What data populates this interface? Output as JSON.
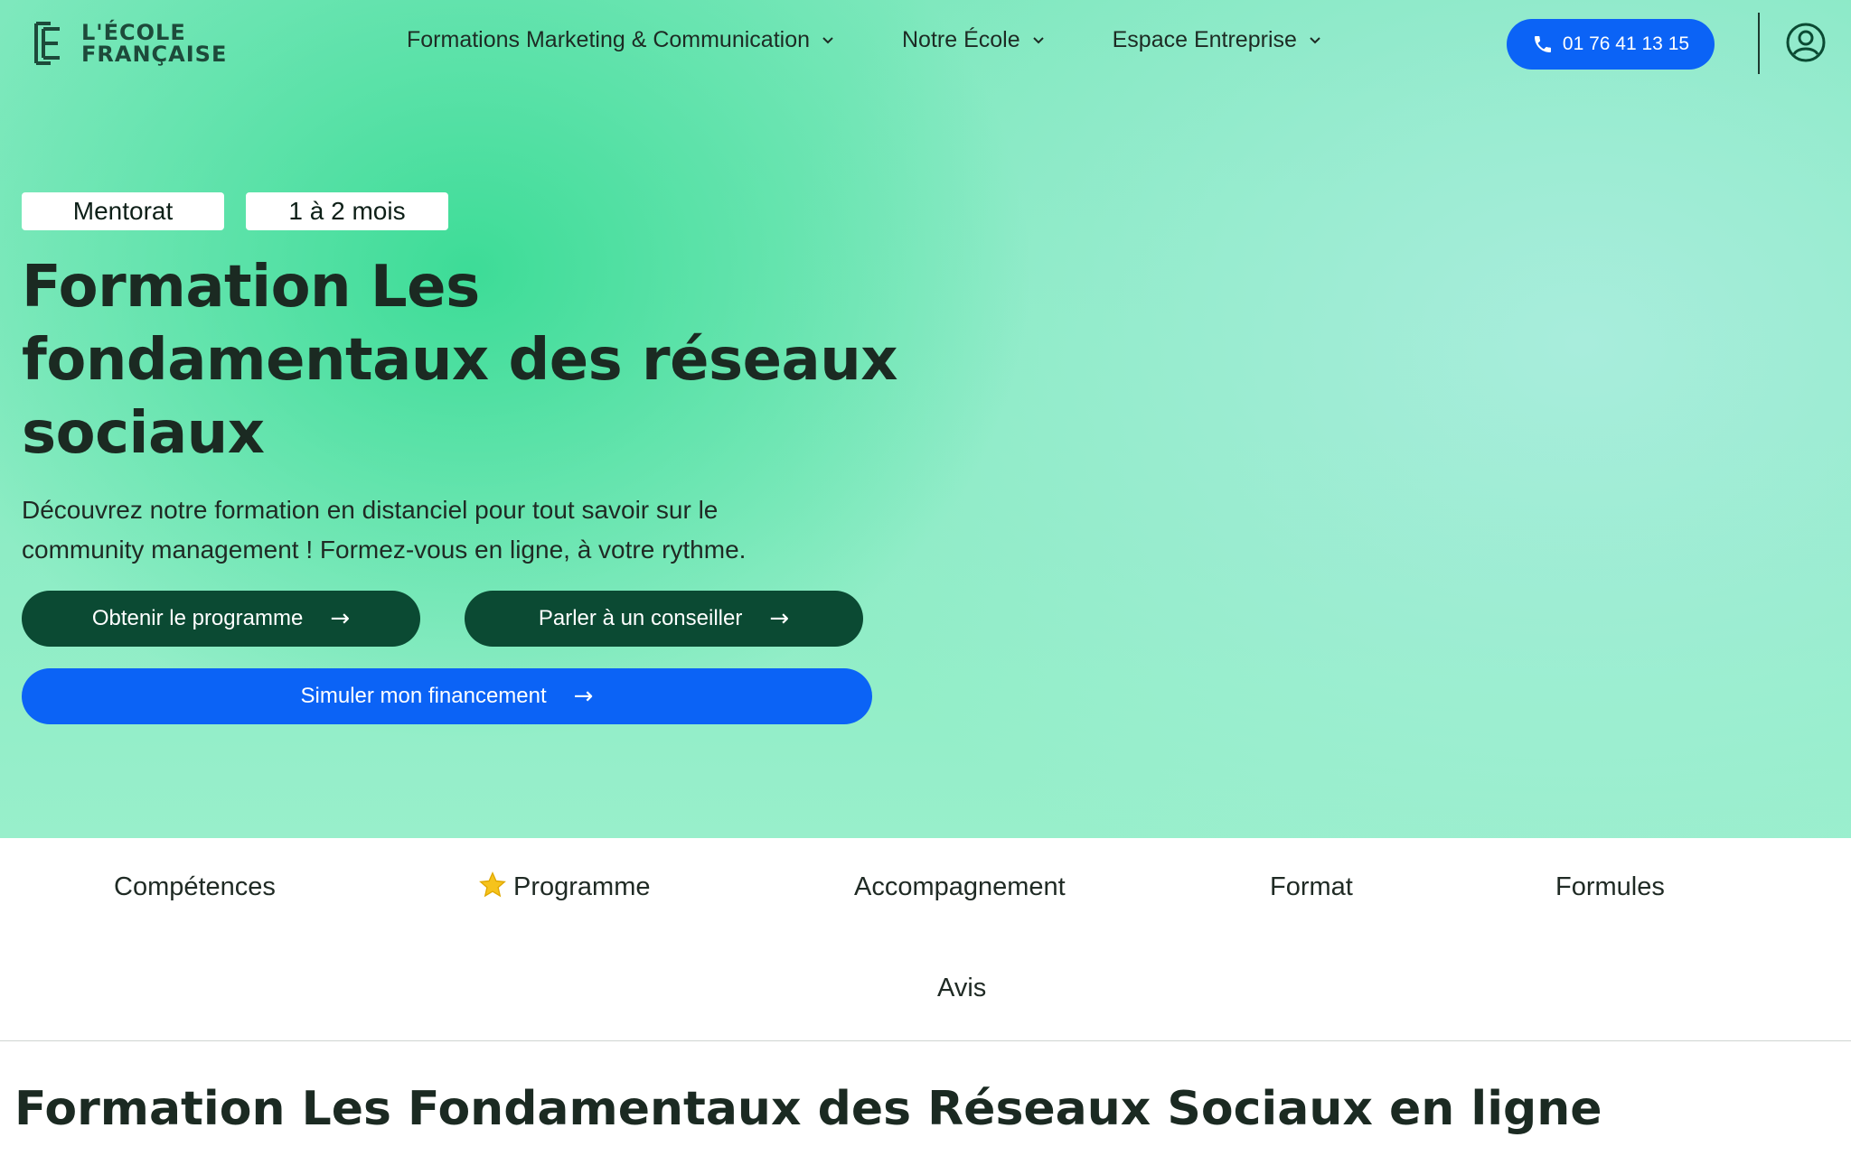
{
  "header": {
    "logo": {
      "line1": "L'ÉCOLE",
      "line2": "FRANÇAISE"
    },
    "nav": [
      {
        "label": "Formations Marketing & Communication"
      },
      {
        "label": "Notre École"
      },
      {
        "label": "Espace Entreprise"
      }
    ],
    "phone": "01 76 41 13 15"
  },
  "hero": {
    "tags": [
      "Mentorat",
      "1 à 2 mois"
    ],
    "title": "Formation Les fondamentaux des réseaux sociaux",
    "subtitle": "Découvrez notre formation en distanciel pour tout savoir sur le community management ! Formez-vous en ligne, à votre rythme.",
    "buttons": {
      "programme": "Obtenir le programme",
      "conseiller": "Parler à un conseiller",
      "financement": "Simuler mon financement"
    }
  },
  "tabs": [
    "Compétences",
    "Programme",
    "Accompagnement",
    "Format",
    "Formules",
    "Avis"
  ],
  "section": {
    "title": "Formation Les Fondamentaux des Réseaux Sociaux en ligne"
  },
  "colors": {
    "accent_blue": "#0b63f6",
    "dark_green": "#0b4a33",
    "hero_green": "#3ddc97"
  },
  "icons": [
    "logo-mark-icon",
    "chevron-down-icon",
    "phone-icon",
    "user-account-icon",
    "arrow-right-icon",
    "star-icon"
  ]
}
